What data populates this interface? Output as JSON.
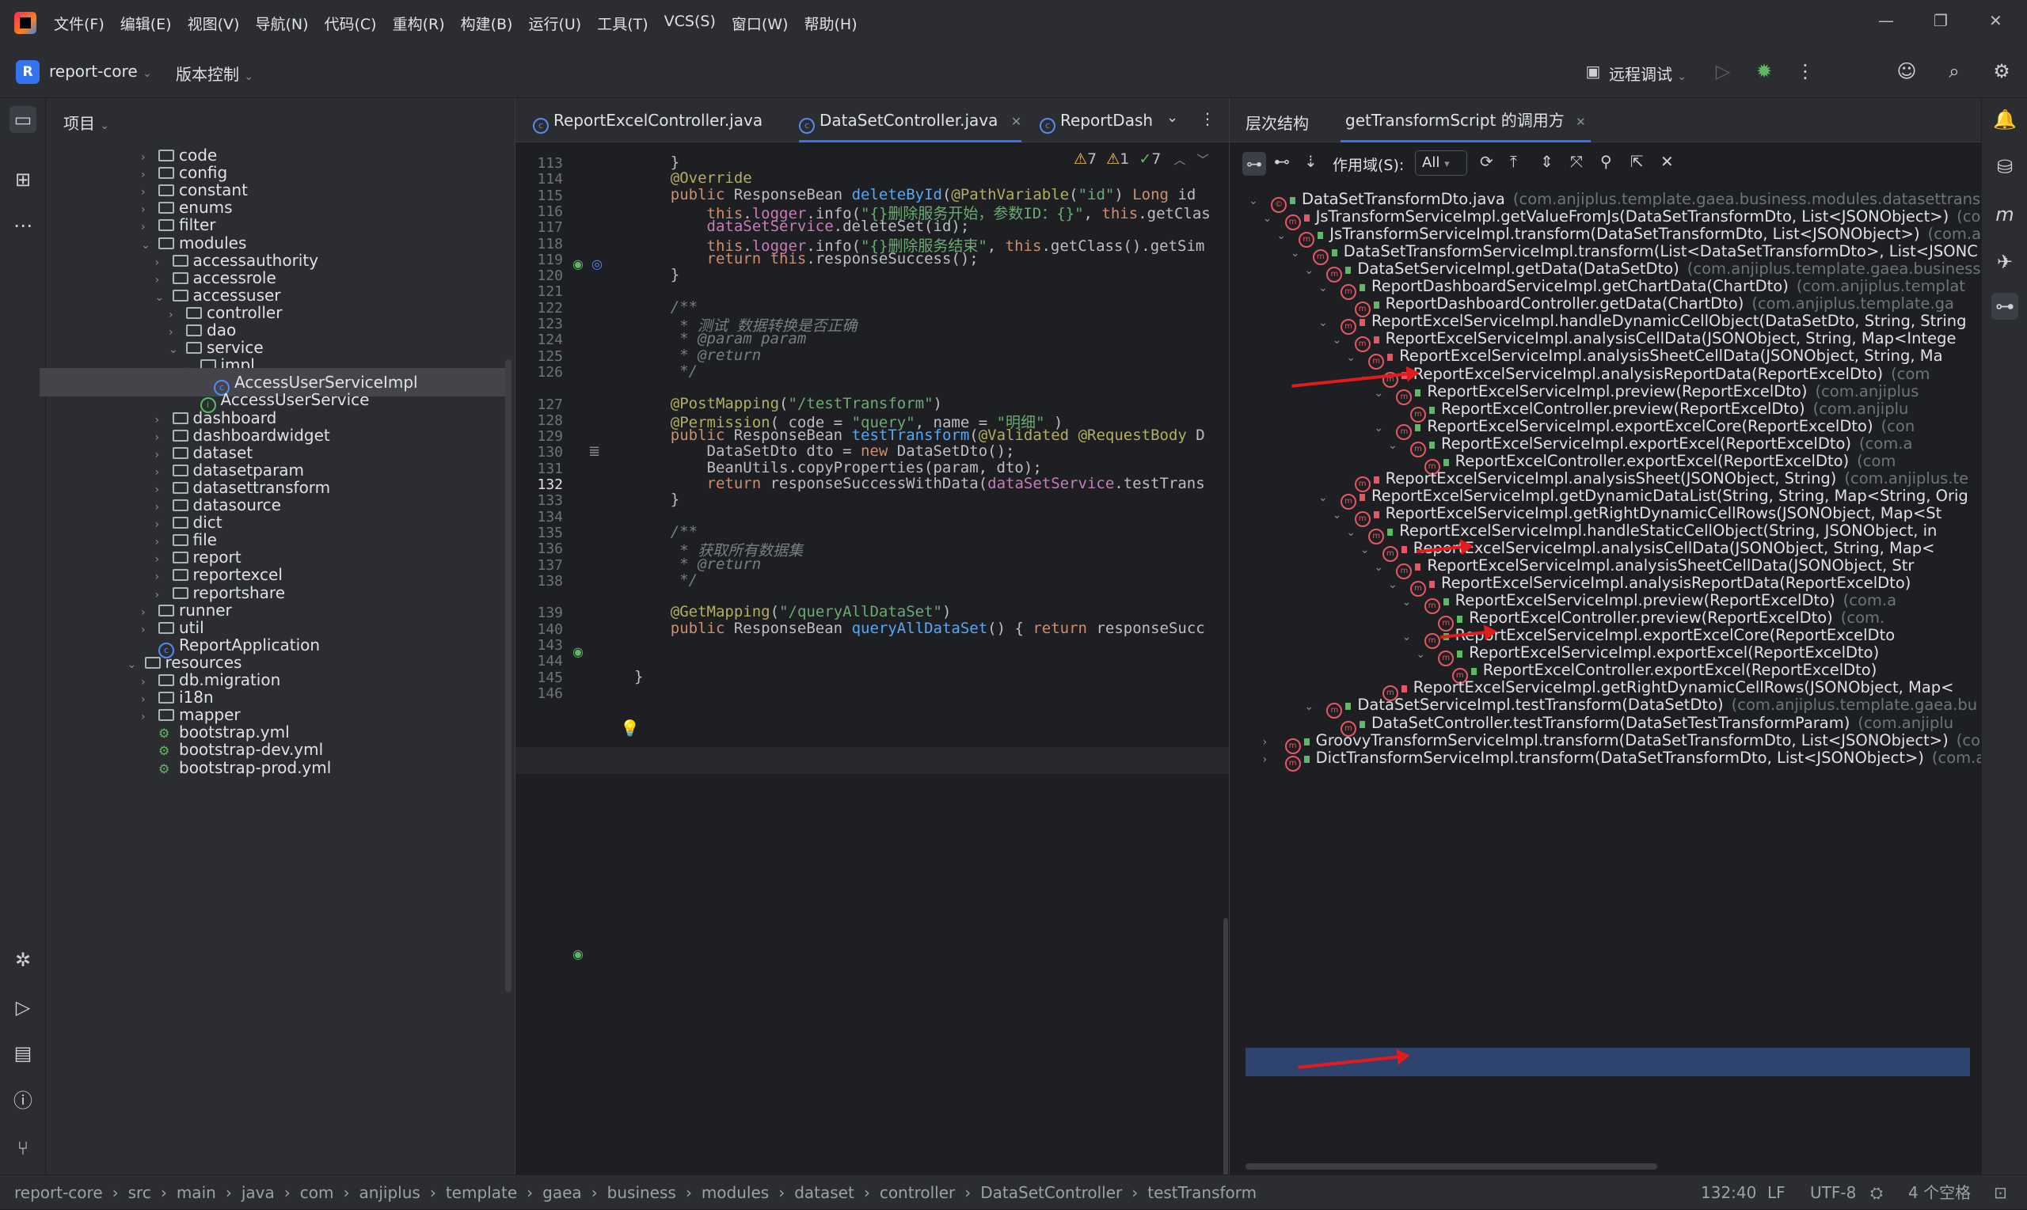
{
  "menubar": {
    "items": [
      "文件(F)",
      "编辑(E)",
      "视图(V)",
      "导航(N)",
      "代码(C)",
      "重构(R)",
      "构建(B)",
      "运行(U)",
      "工具(T)",
      "VCS(S)",
      "窗口(W)",
      "帮助(H)"
    ],
    "window_controls": [
      "—",
      "❐",
      "✕"
    ]
  },
  "toolbar": {
    "project_badge": "R",
    "project_name": "report-core",
    "vcs_label": "版本控制",
    "remote_debug": "远程调试"
  },
  "project_panel": {
    "title": "项目",
    "tree": [
      {
        "label": "code",
        "type": "folder",
        "level": 0,
        "state": "collapsed"
      },
      {
        "label": "config",
        "type": "folder",
        "level": 0,
        "state": "collapsed"
      },
      {
        "label": "constant",
        "type": "folder",
        "level": 0,
        "state": "collapsed"
      },
      {
        "label": "enums",
        "type": "folder",
        "level": 0,
        "state": "collapsed"
      },
      {
        "label": "filter",
        "type": "folder",
        "level": 0,
        "state": "collapsed"
      },
      {
        "label": "modules",
        "type": "folder",
        "level": 0,
        "state": "expanded"
      },
      {
        "label": "accessauthority",
        "type": "folder",
        "level": 1,
        "state": "collapsed"
      },
      {
        "label": "accessrole",
        "type": "folder",
        "level": 1,
        "state": "collapsed"
      },
      {
        "label": "accessuser",
        "type": "folder",
        "level": 1,
        "state": "expanded"
      },
      {
        "label": "controller",
        "type": "folder",
        "level": 2,
        "state": "collapsed"
      },
      {
        "label": "dao",
        "type": "folder",
        "level": 2,
        "state": "collapsed"
      },
      {
        "label": "service",
        "type": "folder",
        "level": 2,
        "state": "expanded"
      },
      {
        "label": "impl",
        "type": "folder",
        "level": 3,
        "state": "expanded"
      },
      {
        "label": "AccessUserServiceImpl",
        "type": "class",
        "level": 4,
        "state": "leaf",
        "selected": true
      },
      {
        "label": "AccessUserService",
        "type": "interface",
        "level": 3,
        "state": "leaf"
      },
      {
        "label": "dashboard",
        "type": "folder",
        "level": 1,
        "state": "collapsed"
      },
      {
        "label": "dashboardwidget",
        "type": "folder",
        "level": 1,
        "state": "collapsed"
      },
      {
        "label": "dataset",
        "type": "folder",
        "level": 1,
        "state": "collapsed"
      },
      {
        "label": "datasetparam",
        "type": "folder",
        "level": 1,
        "state": "collapsed"
      },
      {
        "label": "datasettransform",
        "type": "folder",
        "level": 1,
        "state": "collapsed"
      },
      {
        "label": "datasource",
        "type": "folder",
        "level": 1,
        "state": "collapsed"
      },
      {
        "label": "dict",
        "type": "folder",
        "level": 1,
        "state": "collapsed"
      },
      {
        "label": "file",
        "type": "folder",
        "level": 1,
        "state": "collapsed"
      },
      {
        "label": "report",
        "type": "folder",
        "level": 1,
        "state": "collapsed"
      },
      {
        "label": "reportexcel",
        "type": "folder",
        "level": 1,
        "state": "collapsed"
      },
      {
        "label": "reportshare",
        "type": "folder",
        "level": 1,
        "state": "collapsed"
      },
      {
        "label": "runner",
        "type": "folder",
        "level": 0,
        "state": "collapsed"
      },
      {
        "label": "util",
        "type": "folder",
        "level": 0,
        "state": "collapsed"
      },
      {
        "label": "ReportApplication",
        "type": "class",
        "level": 0,
        "state": "leaf"
      },
      {
        "label": "resources",
        "type": "folder",
        "level": -1,
        "state": "expanded"
      },
      {
        "label": "db.migration",
        "type": "folder",
        "level": 0,
        "state": "collapsed"
      },
      {
        "label": "i18n",
        "type": "folder",
        "level": 0,
        "state": "collapsed"
      },
      {
        "label": "mapper",
        "type": "folder",
        "level": 0,
        "state": "collapsed"
      },
      {
        "label": "bootstrap.yml",
        "type": "yml",
        "level": 0,
        "state": "leaf"
      },
      {
        "label": "bootstrap-dev.yml",
        "type": "yml",
        "level": 0,
        "state": "leaf"
      },
      {
        "label": "bootstrap-prod.yml",
        "type": "yml",
        "level": 0,
        "state": "leaf"
      }
    ]
  },
  "editor": {
    "tabs": [
      {
        "label": "ReportExcelController.java",
        "active": false
      },
      {
        "label": "DataSetController.java",
        "active": true
      },
      {
        "label": "ReportDash",
        "active": false
      }
    ],
    "inspections": {
      "warnings": "7",
      "weak": "1",
      "ok": "7"
    },
    "line_numbers": [
      "113",
      "114",
      "115",
      "116",
      "117",
      "118",
      "119",
      "120",
      "121",
      "122",
      "123",
      "124",
      "125",
      "126",
      "",
      "127",
      "128",
      "129",
      "130",
      "131",
      "132",
      "133",
      "134",
      "135",
      "136",
      "137",
      "138",
      "",
      "139",
      "140",
      "143",
      "144",
      "145",
      "146"
    ],
    "code_lines": [
      "    }",
      "    @Override",
      "    public ResponseBean deleteById(@PathVariable(\"id\") Long id",
      "        this.logger.info(\"{}删除服务开始，参数ID：{}\", this.getClas",
      "        dataSetService.deleteSet(id);",
      "        this.logger.info(\"{}删除服务结束\", this.getClass().getSim",
      "        return this.responseSuccess();",
      "    }",
      "",
      "    /**",
      "     * 测试 数据转换是否正确",
      "     * @param param",
      "     * @return",
      "     */",
      "",
      "    @PostMapping(\"/testTransform\")",
      "    @Permission( code = \"query\", name = \"明细\" )",
      "    public ResponseBean testTransform(@Validated @RequestBody D",
      "        DataSetDto dto = new DataSetDto();",
      "        BeanUtils.copyProperties(param, dto);",
      "        return responseSuccessWithData(dataSetService.testTrans",
      "    }",
      "",
      "    /**",
      "     * 获取所有数据集",
      "     * @return",
      "     */",
      "",
      "    @GetMapping(\"/queryAllDataSet\")",
      "    public ResponseBean queryAllDataSet() { return responseSucc",
      "",
      "",
      "}",
      ""
    ]
  },
  "hierarchy": {
    "tabs": [
      "层次结构",
      "getTransformScript 的调用方"
    ],
    "scope_label": "作用域(S):",
    "scope_value": "All",
    "rows": [
      {
        "level": 0,
        "text": "DataSetTransformDto.java",
        "pkg": "(com.anjiplus.template.gaea.business.modules.datasettransfor",
        "arrow": "v",
        "type": "class"
      },
      {
        "level": 1,
        "text": "JsTransformServiceImpl.getValueFromJs(DataSetTransformDto, List<JSONObject>)",
        "pkg": "(co",
        "arrow": "v",
        "type": "m-red"
      },
      {
        "level": 2,
        "text": "JsTransformServiceImpl.transform(DataSetTransformDto, List<JSONObject>)",
        "pkg": "(com.a",
        "arrow": "v",
        "type": "m"
      },
      {
        "level": 3,
        "text": "DataSetTransformServiceImpl.transform(List<DataSetTransformDto>, List<JSONC",
        "pkg": "",
        "arrow": "v",
        "type": "m"
      },
      {
        "level": 4,
        "text": "DataSetServiceImpl.getData(DataSetDto)",
        "pkg": "(com.anjiplus.template.gaea.business",
        "arrow": "v",
        "type": "m"
      },
      {
        "level": 5,
        "text": "ReportDashboardServiceImpl.getChartData(ChartDto)",
        "pkg": "(com.anjiplus.templat",
        "arrow": "v",
        "type": "m"
      },
      {
        "level": 6,
        "text": "ReportDashboardController.getData(ChartDto)",
        "pkg": "(com.anjiplus.template.ga",
        "arrow": "",
        "type": "m",
        "marked": true
      },
      {
        "level": 5,
        "text": "ReportExcelServiceImpl.handleDynamicCellObject(DataSetDto, String, String",
        "pkg": "",
        "arrow": "v",
        "type": "m-red"
      },
      {
        "level": 6,
        "text": "ReportExcelServiceImpl.analysisCellData(JSONObject, String, Map<Intege",
        "pkg": "",
        "arrow": "v",
        "type": "m-red"
      },
      {
        "level": 7,
        "text": "ReportExcelServiceImpl.analysisSheetCellData(JSONObject, String, Ma",
        "pkg": "",
        "arrow": "v",
        "type": "m-red"
      },
      {
        "level": 8,
        "text": "ReportExcelServiceImpl.analysisReportData(ReportExcelDto)",
        "pkg": "(com",
        "arrow": "v",
        "type": "m-red"
      },
      {
        "level": 9,
        "text": "ReportExcelServiceImpl.preview(ReportExcelDto)",
        "pkg": "(com.anjiplus",
        "arrow": "v",
        "type": "m"
      },
      {
        "level": 10,
        "text": "ReportExcelController.preview(ReportExcelDto)",
        "pkg": "(com.anjiplu",
        "arrow": "",
        "type": "m",
        "marked": true
      },
      {
        "level": 9,
        "text": "ReportExcelServiceImpl.exportExcelCore(ReportExcelDto)",
        "pkg": "(con",
        "arrow": "v",
        "type": "m"
      },
      {
        "level": 10,
        "text": "ReportExcelServiceImpl.exportExcel(ReportExcelDto)",
        "pkg": "(com.a",
        "arrow": "v",
        "type": "m"
      },
      {
        "level": 11,
        "text": "ReportExcelController.exportExcel(ReportExcelDto)",
        "pkg": "(com",
        "arrow": "",
        "type": "m",
        "marked": true
      },
      {
        "level": 6,
        "text": "ReportExcelServiceImpl.analysisSheet(JSONObject, String)",
        "pkg": "(com.anjiplus.te",
        "arrow": "",
        "type": "m-red"
      },
      {
        "level": 5,
        "text": "ReportExcelServiceImpl.getDynamicDataList(String, String, Map<String, Orig",
        "pkg": "",
        "arrow": "v",
        "type": "m-red"
      },
      {
        "level": 6,
        "text": "ReportExcelServiceImpl.getRightDynamicCellRows(JSONObject, Map<St",
        "pkg": "",
        "arrow": "v",
        "type": "m-red"
      },
      {
        "level": 7,
        "text": "ReportExcelServiceImpl.handleStaticCellObject(String, JSONObject, in",
        "pkg": "",
        "arrow": "v",
        "type": "m"
      },
      {
        "level": 8,
        "text": "ReportExcelServiceImpl.analysisCellData(JSONObject, String, Map<",
        "pkg": "",
        "arrow": "v",
        "type": "m-red"
      },
      {
        "level": 9,
        "text": "ReportExcelServiceImpl.analysisSheetCellData(JSONObject, Str",
        "pkg": "",
        "arrow": "v",
        "type": "m-red"
      },
      {
        "level": 10,
        "text": "ReportExcelServiceImpl.analysisReportData(ReportExcelDto)",
        "pkg": "",
        "arrow": "v",
        "type": "m-red"
      },
      {
        "level": 11,
        "text": "ReportExcelServiceImpl.preview(ReportExcelDto)",
        "pkg": "(com.a",
        "arrow": "v",
        "type": "m"
      },
      {
        "level": 12,
        "text": "ReportExcelController.preview(ReportExcelDto)",
        "pkg": "(com.",
        "arrow": "",
        "type": "m"
      },
      {
        "level": 11,
        "text": "ReportExcelServiceImpl.exportExcelCore(ReportExcelDto",
        "pkg": "",
        "arrow": "v",
        "type": "m"
      },
      {
        "level": 12,
        "text": "ReportExcelServiceImpl.exportExcel(ReportExcelDto)",
        "pkg": "",
        "arrow": "v",
        "type": "m"
      },
      {
        "level": 13,
        "text": "ReportExcelController.exportExcel(ReportExcelDto)",
        "pkg": "",
        "arrow": "",
        "type": "m"
      },
      {
        "level": 8,
        "text": "ReportExcelServiceImpl.getRightDynamicCellRows(JSONObject, Map<",
        "pkg": "",
        "arrow": "",
        "type": "m-red"
      },
      {
        "level": 4,
        "text": "DataSetServiceImpl.testTransform(DataSetDto)",
        "pkg": "(com.anjiplus.template.gaea.bu",
        "arrow": "v",
        "type": "m"
      },
      {
        "level": 5,
        "text": "DataSetController.testTransform(DataSetTestTransformParam)",
        "pkg": "(com.anjiplu",
        "arrow": "",
        "type": "m",
        "marked": true,
        "selected": true
      },
      {
        "level": 1,
        "text": "GroovyTransformServiceImpl.transform(DataSetTransformDto, List<JSONObject>)",
        "pkg": "(com",
        "arrow": ">",
        "type": "m"
      },
      {
        "level": 1,
        "text": "DictTransformServiceImpl.transform(DataSetTransformDto, List<JSONObject>)",
        "pkg": "(com.an",
        "arrow": ">",
        "type": "m"
      }
    ]
  },
  "statusbar": {
    "breadcrumb": [
      "report-core",
      "src",
      "main",
      "java",
      "com",
      "anjiplus",
      "template",
      "gaea",
      "business",
      "modules",
      "dataset",
      "controller",
      "DataSetController",
      "testTransform"
    ],
    "separator": "›",
    "position": "132:40",
    "line_ending": "LF",
    "encoding": "UTF-8",
    "indent": "4 个空格"
  },
  "colors": {
    "accent": "#3574f0",
    "annotation_arrow": "#e41b1b"
  }
}
